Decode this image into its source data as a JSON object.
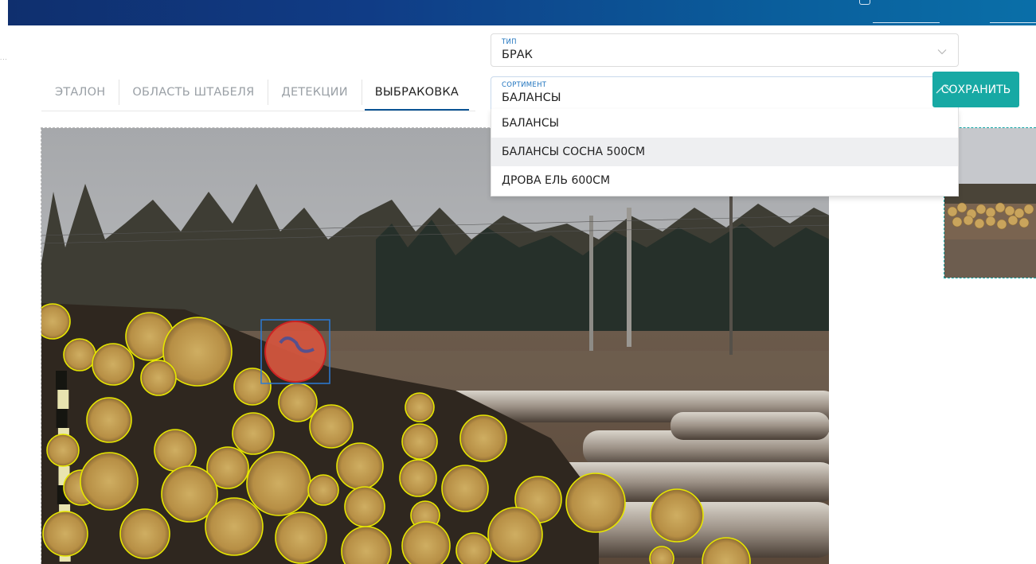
{
  "tabs": [
    {
      "label": "ЭТАЛОН",
      "active": false
    },
    {
      "label": "ОБЛАСТЬ ШТАБЕЛЯ",
      "active": false
    },
    {
      "label": "ДЕТЕКЦИИ",
      "active": false
    },
    {
      "label": "ВЫБРАКОВКА",
      "active": true
    }
  ],
  "form": {
    "type_label": "ТИП",
    "type_value": "БРАК",
    "sort_label": "СОРТИМЕНТ",
    "sort_value": "БАЛАНСЫ"
  },
  "dropdown": {
    "options": [
      "БАЛАНСЫ",
      "БАЛАНСЫ СОСНА 500СМ",
      "ДРОВА ЕЛЬ 600СМ"
    ],
    "highlighted_index": 1
  },
  "save_label": "СОХРАНИТЬ",
  "colors": {
    "header": "#0f2f6e",
    "accent": "#0b5394",
    "save": "#17a9a4",
    "detection": "#e6e600",
    "selected_detection": "#cc2222",
    "selection_box": "#2b7bd6"
  },
  "icons": {
    "chevron": "chevron-down-icon",
    "ruler": "measurement-scale"
  }
}
